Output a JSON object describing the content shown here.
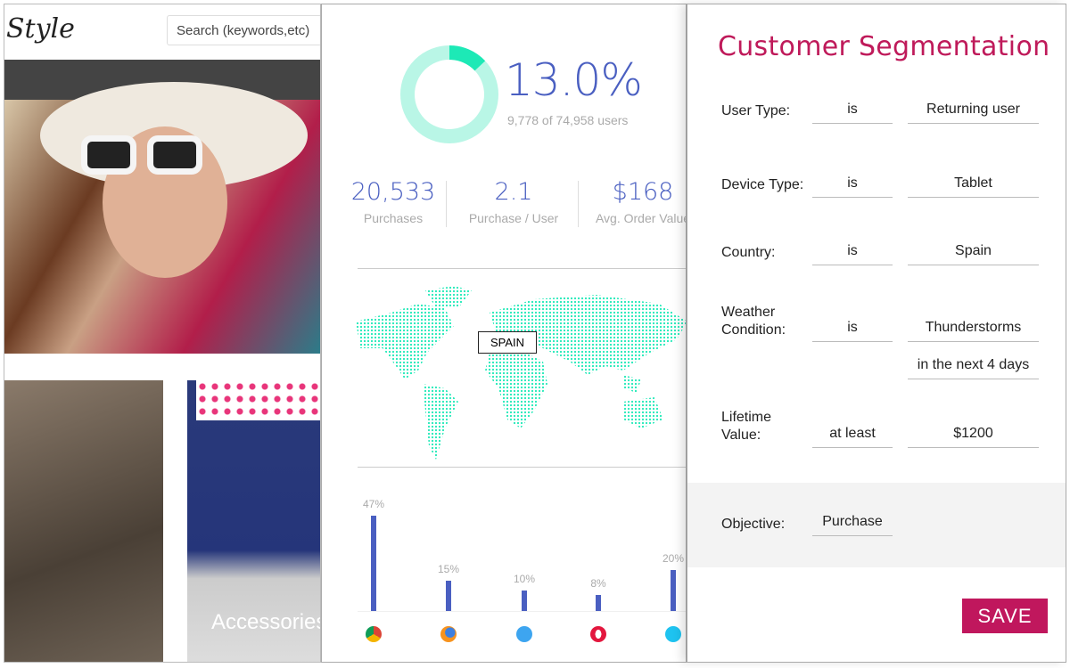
{
  "site": {
    "logo": "Style",
    "search_placeholder": "Search (keywords,etc)",
    "tile_label": "Accessories"
  },
  "dashboard": {
    "conversion": {
      "percent_label": "13.0%",
      "percent": 13.0,
      "users_text": "9,778 of 74,958 users"
    },
    "stats": [
      {
        "value": "20,533",
        "label": "Purchases"
      },
      {
        "value": "2.1",
        "label": "Purchase / User"
      },
      {
        "value": "$168",
        "label": "Avg. Order Value"
      }
    ],
    "map_tooltip": "SPAIN",
    "colors": {
      "accent": "#4a5fc1",
      "teal": "#1de9b6",
      "teal_light": "#b9f6e6"
    },
    "browsers": [
      {
        "name": "chrome-icon",
        "label": "47%",
        "value": 47
      },
      {
        "name": "firefox-icon",
        "label": "15%",
        "value": 15
      },
      {
        "name": "ie-icon",
        "label": "10%",
        "value": 10
      },
      {
        "name": "opera-icon",
        "label": "8%",
        "value": 8
      },
      {
        "name": "safari-icon",
        "label": "20%",
        "value": 20
      }
    ]
  },
  "segmentation": {
    "title": "Customer Segmentation",
    "rows": [
      {
        "label": "User Type:",
        "op": "is",
        "value": "Returning user"
      },
      {
        "label": "Device Type:",
        "op": "is",
        "value": "Tablet"
      },
      {
        "label": "Country:",
        "op": "is",
        "value": "Spain"
      },
      {
        "label": "Weather Condition:",
        "op": "is",
        "value": "Thunderstorms",
        "extra": "in the next 4 days"
      },
      {
        "label": "Lifetime Value:",
        "op": "at least",
        "value": "$1200"
      }
    ],
    "objective_label": "Objective:",
    "objective_value": "Purchase",
    "save_label": "SAVE",
    "color": "#c0175d"
  }
}
